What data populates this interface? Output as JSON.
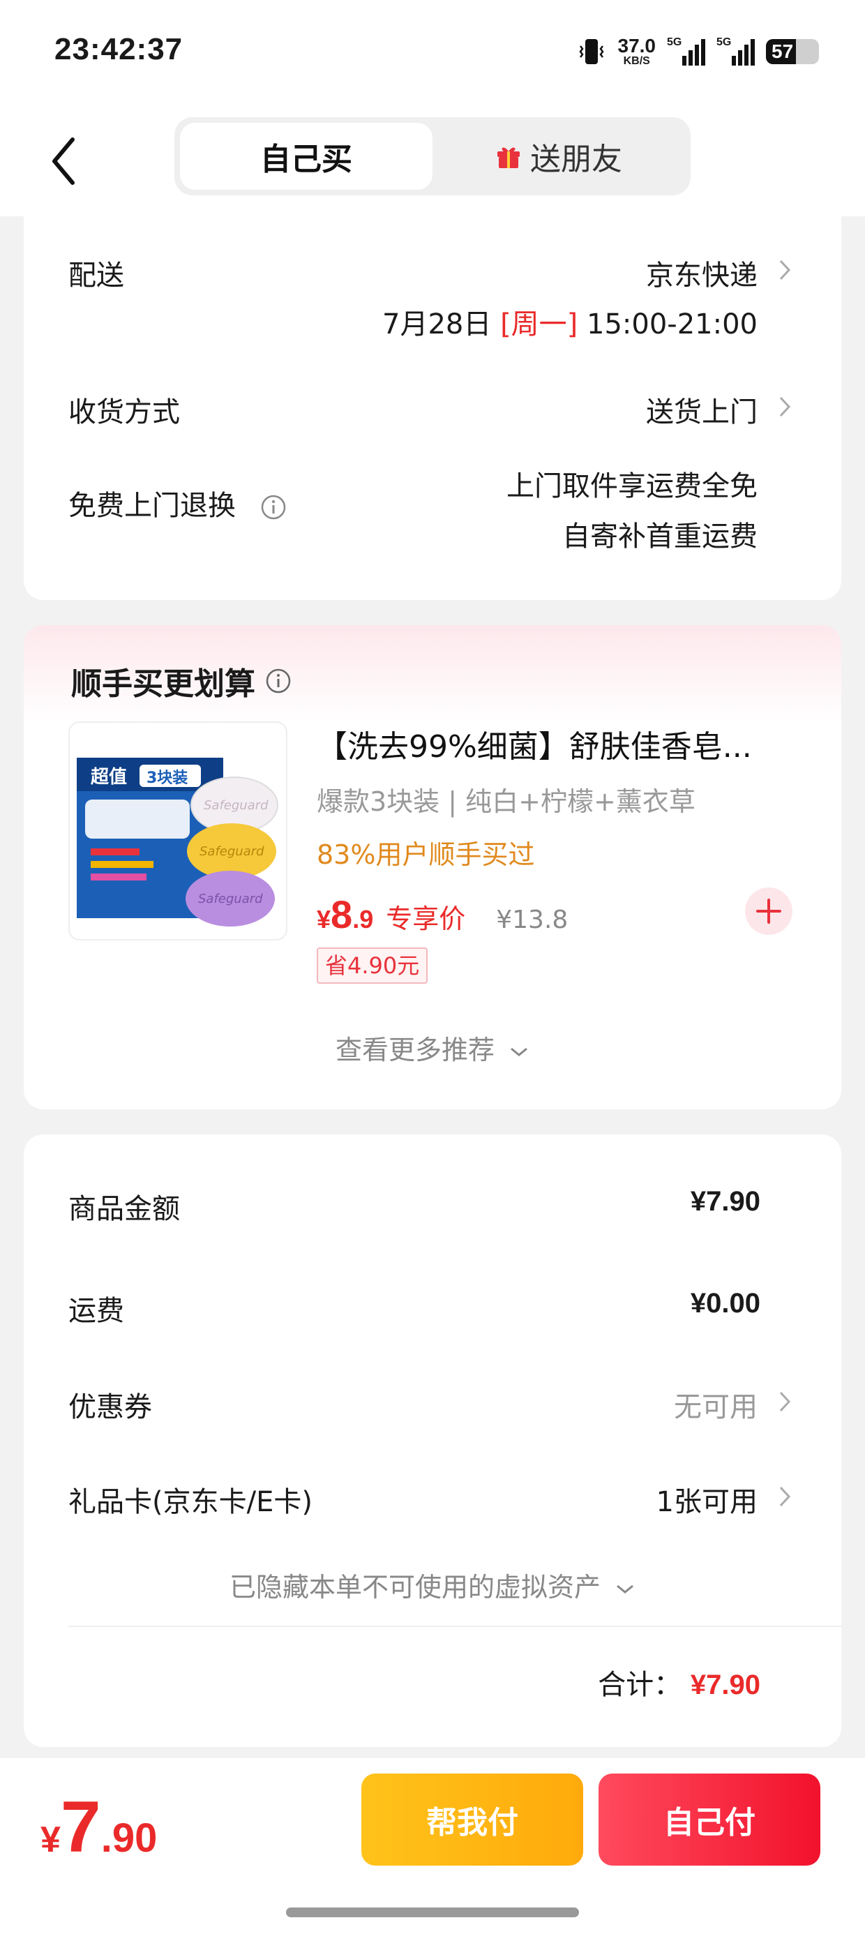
{
  "status_bar": {
    "time": "23:42:37",
    "speed_value": "37.0",
    "speed_unit": "KB/S",
    "net1": "5G",
    "net2": "5G",
    "battery": "57",
    "battery_level": 0.57
  },
  "header": {
    "tab_self": "自己买",
    "tab_gift": "送朋友"
  },
  "delivery": {
    "label": "配送",
    "carrier": "京东快递",
    "date": "7月28日",
    "weekday": "[周一]",
    "time_window": "15:00-21:00",
    "receive_label": "收货方式",
    "receive_value": "送货上门",
    "return_label": "免费上门退换",
    "return_line1": "上门取件享运费全免",
    "return_line2": "自寄补首重运费"
  },
  "recommend": {
    "title": "顺手买更划算",
    "product_title": "【洗去99%细菌】舒肤佳香皂...",
    "product_spec": "爆款3块装 | 纯白+柠檬+薰衣草",
    "buy_rate": "83%用户顺手买过",
    "price_currency": "¥",
    "price_int": "8",
    "price_dec": ".9",
    "price_tag": "专享价",
    "price_old": "¥13.8",
    "save": "省4.90元",
    "more": "查看更多推荐",
    "pack_label": "超值",
    "pack_count": "3块装",
    "brand": "Safeguard"
  },
  "summary": {
    "goods_label": "商品金额",
    "goods_value": "¥7.90",
    "shipping_label": "运费",
    "shipping_value": "¥0.00",
    "coupon_label": "优惠券",
    "coupon_value": "无可用",
    "giftcard_label": "礼品卡(京东卡/E卡)",
    "giftcard_value": "1张可用",
    "hidden_note": "已隐藏本单不可使用的虚拟资产",
    "total_label": "合计：",
    "total_value": "¥7.90"
  },
  "bottom": {
    "currency": "¥",
    "price_int": "7",
    "price_dec": ".90",
    "help_pay": "帮我付",
    "self_pay": "自己付"
  },
  "colors": {
    "accent_red": "#ea2a2a",
    "help_yellow": "#ffb612",
    "pay_red": "#f2122d",
    "orange_text": "#e08a1e"
  }
}
